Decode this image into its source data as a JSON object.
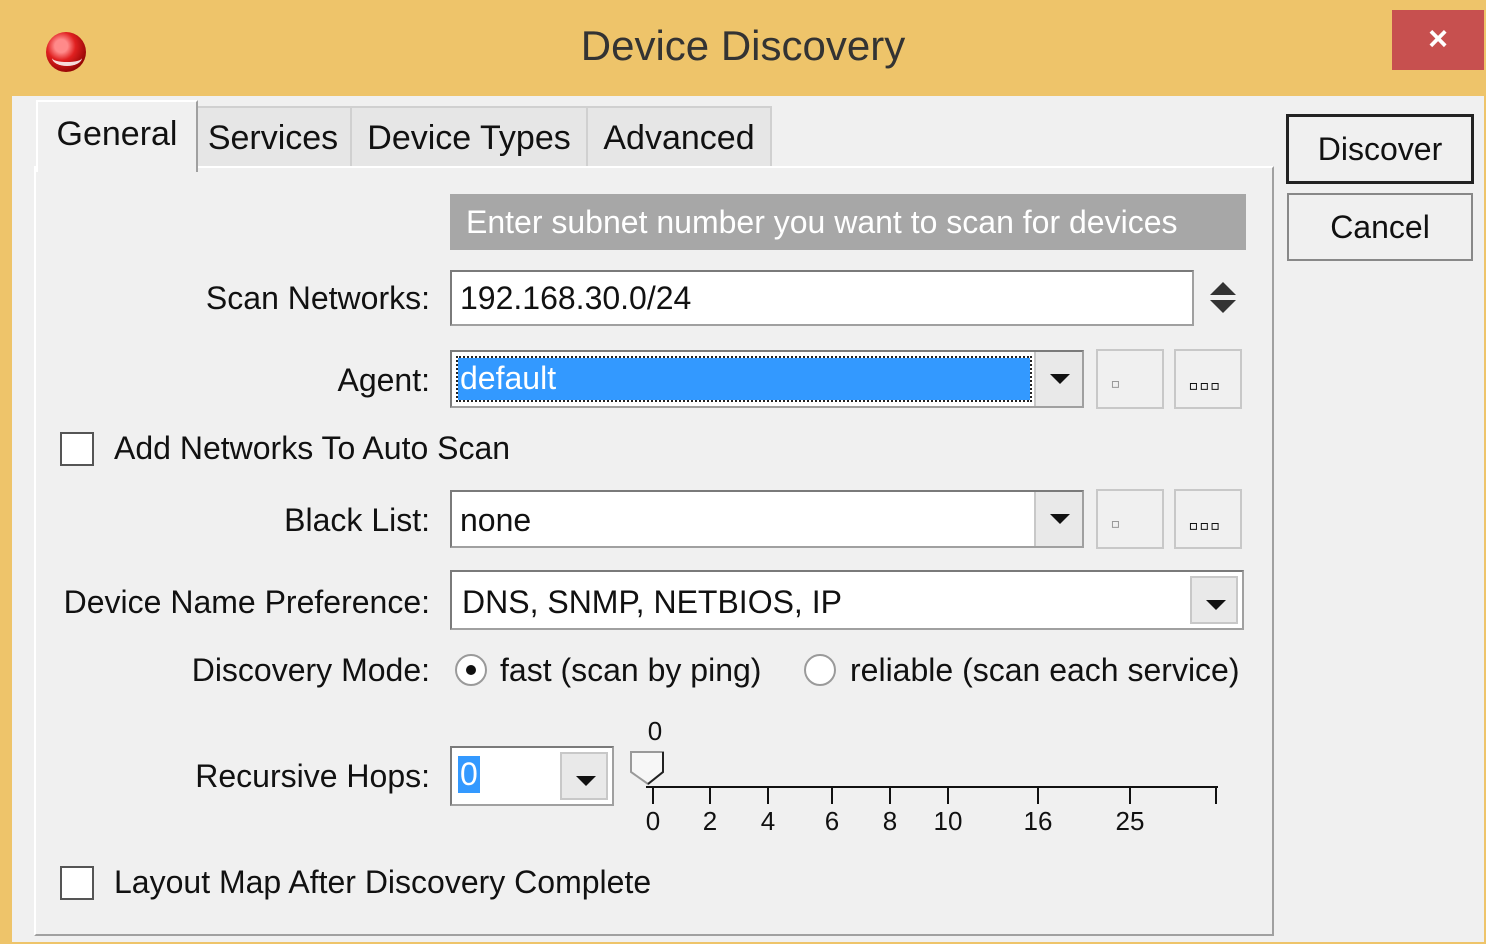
{
  "window": {
    "title": "Device Discovery",
    "close_glyph": "×"
  },
  "tabs": [
    "General",
    "Services",
    "Device Types",
    "Advanced"
  ],
  "buttons": {
    "discover": "Discover",
    "cancel": "Cancel"
  },
  "hint": "Enter subnet number you want to scan for devices",
  "scan_networks": {
    "label": "Scan Networks:",
    "value": "192.168.30.0/24"
  },
  "agent": {
    "label": "Agent:",
    "value": "default"
  },
  "add_networks": {
    "label": "Add Networks To Auto Scan",
    "checked": false
  },
  "black_list": {
    "label": "Black List:",
    "value": "none"
  },
  "device_name_preference": {
    "label": "Device Name Preference:",
    "value": "DNS, SNMP, NETBIOS, IP"
  },
  "discovery_mode": {
    "label": "Discovery Mode:",
    "options": [
      "fast (scan by ping)",
      "reliable (scan each service)"
    ],
    "selected": "fast (scan by ping)"
  },
  "recursive_hops": {
    "label": "Recursive Hops:",
    "value": "0",
    "slider_value": "0",
    "ticks": [
      "0",
      "2",
      "4",
      "6",
      "8",
      "10",
      "16",
      "25"
    ]
  },
  "layout_map": {
    "label": "Layout Map After Discovery Complete",
    "checked": false
  },
  "square_button_glyphs": {
    "small": "▫",
    "more": "▫▫▫"
  },
  "icons": [
    "app-logo-icon",
    "close-icon",
    "sort-updown-icon",
    "dropdown-arrow-icon"
  ],
  "colors": {
    "frame": "#eec46a",
    "close": "#c7504f",
    "selection": "#3399ff",
    "hint_bg": "#a7a7a7"
  }
}
